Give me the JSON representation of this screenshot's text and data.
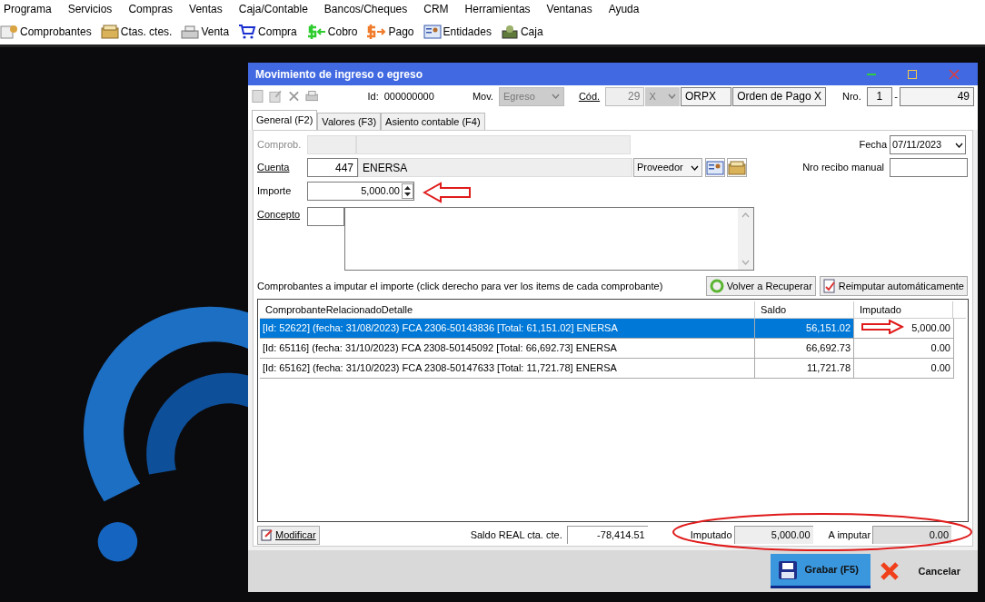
{
  "menu": [
    "Programa",
    "Servicios",
    "Compras",
    "Ventas",
    "Caja/Contable",
    "Bancos/Cheques",
    "CRM",
    "Herramientas",
    "Ventanas",
    "Ayuda"
  ],
  "toolbar": [
    "Comprobantes",
    "Ctas. ctes.",
    "Venta",
    "Compra",
    "Cobro",
    "Pago",
    "Entidades",
    "Caja"
  ],
  "window": {
    "title": "Movimiento de ingreso o egreso"
  },
  "header": {
    "id_label": "Id:",
    "id_value": "000000000",
    "mov_label": "Mov.",
    "mov_value": "Egreso",
    "cod_label": "Cód.",
    "cod_value": "29",
    "cod_series": "X",
    "cod_code": "ORPX",
    "cod_name": "Orden de Pago X",
    "nro_label": "Nro.",
    "nro_prefix": "1",
    "nro_sep": "-",
    "nro_number": "49"
  },
  "tabs": [
    {
      "label": "General (F2)",
      "selected": true
    },
    {
      "label": "Valores (F3)",
      "selected": false
    },
    {
      "label": "Asiento contable (F4)",
      "selected": false
    }
  ],
  "form": {
    "comprob_label": "Comprob.",
    "fecha_label": "Fecha",
    "fecha_value": "07/11/2023",
    "cuenta_label": "Cuenta",
    "cuenta_code": "447",
    "cuenta_name": "ENERSA",
    "cuenta_type": "Proveedor",
    "nro_recibo_label": "Nro recibo manual",
    "importe_label": "Importe",
    "importe_value": "5,000.00",
    "concepto_label": "Concepto"
  },
  "grid": {
    "caption": "Comprobantes a imputar el importe (click derecho para ver los items de cada comprobante)",
    "buttons": [
      "Volver a Recuperar",
      "Reimputar automáticamente"
    ],
    "columns": [
      "ComprobanteRelacionadoDetalle",
      "Saldo",
      "Imputado"
    ],
    "rows": [
      {
        "cells": [
          "[Id: 52622] (fecha: 31/08/2023) FCA 2306-50143836 [Total: 61,151.02] ENERSA",
          "56,151.02",
          "5,000.00"
        ],
        "selected": true
      },
      {
        "cells": [
          "[Id: 65116] (fecha: 31/10/2023) FCA 2308-50145092 [Total: 66,692.73] ENERSA",
          "66,692.73",
          "0.00"
        ],
        "selected": false
      },
      {
        "cells": [
          "[Id: 65162] (fecha: 31/10/2023) FCA 2308-50147633 [Total: 11,721.78] ENERSA",
          "11,721.78",
          "0.00"
        ],
        "selected": false
      }
    ]
  },
  "footer": {
    "modificar": "Modificar",
    "saldo_label": "Saldo REAL cta. cte.",
    "saldo_value": "-78,414.51",
    "imputado_label": "Imputado",
    "imputado_value": "5,000.00",
    "a_imputar_label": "A imputar",
    "a_imputar_value": "0.00"
  },
  "actions": {
    "save": "Grabar (F5)",
    "cancel": "Cancelar"
  }
}
